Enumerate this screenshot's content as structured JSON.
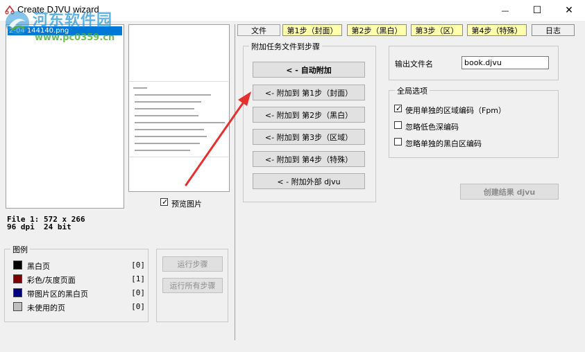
{
  "window": {
    "title": "Create DJVU wizard",
    "minimize_glyph": "—",
    "maximize_glyph": "☐",
    "close_glyph": "✕"
  },
  "watermark": {
    "title": "河东软件园",
    "url": "www.pc0359.cn"
  },
  "file_list": {
    "items": [
      {
        "label": "2-04 144140.png",
        "selected": true
      }
    ]
  },
  "preview": {
    "checkbox_label": "预览图片",
    "checked": true
  },
  "file_info": {
    "line1": "File 1: 572 x 266",
    "line2": "96 dpi  24 bit"
  },
  "legend": {
    "title": "图例",
    "items": [
      {
        "label": "黑白页",
        "count": "[0]",
        "color": "#000000"
      },
      {
        "label": "彩色/灰度页面",
        "count": "[1]",
        "color": "#800000"
      },
      {
        "label": "带图片区的黑白页",
        "count": "[0]",
        "color": "#000080"
      },
      {
        "label": "未使用的页",
        "count": "[0]",
        "color": "#c0c0c0"
      }
    ]
  },
  "run": {
    "run_step": "运行步骤",
    "run_all": "运行所有步骤"
  },
  "tabs": [
    {
      "label": "文件",
      "active": true
    },
    {
      "label": "第1步（封面）"
    },
    {
      "label": "第2步（黑白）"
    },
    {
      "label": "第3步（区）"
    },
    {
      "label": "第4步（特殊）"
    },
    {
      "label": "日志"
    }
  ],
  "attach": {
    "title": "附加任务文件到步骤",
    "auto": "< - 自动附加",
    "step1": "<- 附加到 第1步（封面）",
    "step2": "<- 附加到 第2步（黑白）",
    "step3": "<- 附加到 第3步（区域）",
    "step4": "<- 附加到 第4步（特殊）",
    "external": "< - 附加外部 djvu"
  },
  "output": {
    "label": "输出文件名",
    "value": "book.djvu"
  },
  "global_options": {
    "title": "全局选项",
    "items": [
      {
        "label": "使用单独的区域编码（Fpm）",
        "checked": true
      },
      {
        "label": "忽略低色深编码",
        "checked": false
      },
      {
        "label": "忽略单独的黑白区编码",
        "checked": false
      }
    ]
  },
  "create_button": "创建结果 djvu",
  "colors": {
    "selection": "#0078d7",
    "tab_bg": "#ffffb0",
    "arrow": "#e53030"
  }
}
